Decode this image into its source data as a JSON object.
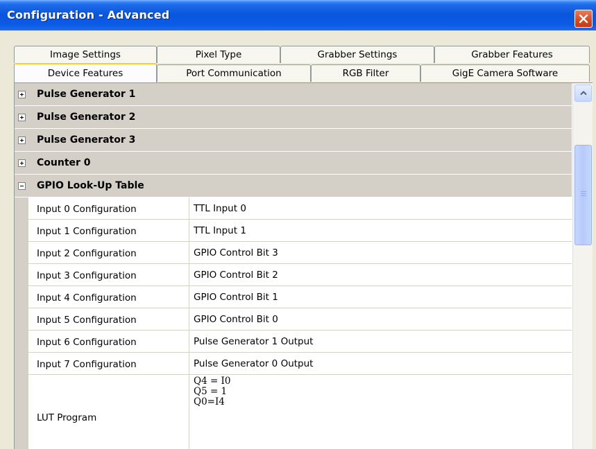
{
  "window": {
    "title": "Configuration - Advanced"
  },
  "tabs": {
    "row1": [
      "Image Settings",
      "Pixel Type",
      "Grabber Settings",
      "Grabber Features"
    ],
    "row2": [
      "Device Features",
      "Port Communication",
      "RGB Filter",
      "GigE Camera Software"
    ],
    "active": "Device Features"
  },
  "categories": [
    {
      "label": "Pulse Generator 1",
      "expanded": false
    },
    {
      "label": "Pulse Generator 2",
      "expanded": false
    },
    {
      "label": "Pulse Generator 3",
      "expanded": false
    },
    {
      "label": "Counter 0",
      "expanded": false
    },
    {
      "label": "GPIO Look-Up Table",
      "expanded": true
    }
  ],
  "properties": [
    {
      "name": "Input 0 Configuration",
      "value": "TTL Input 0"
    },
    {
      "name": "Input 1 Configuration",
      "value": "TTL Input 1"
    },
    {
      "name": "Input 2 Configuration",
      "value": "GPIO Control Bit 3"
    },
    {
      "name": "Input 3 Configuration",
      "value": "GPIO Control Bit 2"
    },
    {
      "name": "Input 4 Configuration",
      "value": "GPIO Control Bit 1"
    },
    {
      "name": "Input 5 Configuration",
      "value": "GPIO Control Bit 0"
    },
    {
      "name": "Input 6 Configuration",
      "value": "Pulse Generator 1 Output"
    },
    {
      "name": "Input 7 Configuration",
      "value": "Pulse Generator 0 Output"
    }
  ],
  "lut": {
    "name": "LUT Program",
    "value": "Q4 = I0\nQ5 = 1\nQ0=I4"
  },
  "icons": {
    "close": "close-icon",
    "expand": "plus-icon",
    "collapse": "minus-icon",
    "scroll_up": "arrow-up-icon"
  }
}
